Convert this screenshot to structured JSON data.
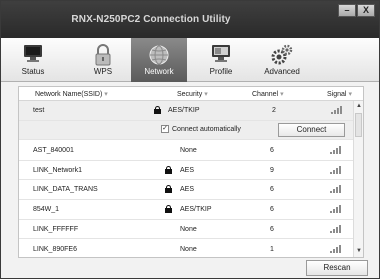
{
  "window": {
    "title": "RNX-N250PC2 Connection Utility",
    "minimize": "–",
    "close": "X"
  },
  "toolbar": {
    "tabs": [
      {
        "label": "Status",
        "icon": "monitor-icon"
      },
      {
        "label": "WPS",
        "icon": "lock-icon"
      },
      {
        "label": "Network",
        "icon": "globe-icon",
        "active": true
      },
      {
        "label": "Profile",
        "icon": "profile-monitor-icon"
      },
      {
        "label": "Advanced",
        "icon": "gears-icon"
      }
    ]
  },
  "table": {
    "headers": {
      "ssid": "Network Name(SSID)",
      "security": "Security",
      "channel": "Channel",
      "signal": "Signal"
    },
    "rows": [
      {
        "ssid": "test",
        "security": "AES/TKIP",
        "locked": true,
        "channel": "2",
        "signal": 4,
        "selected": true
      },
      {
        "ssid": "AST_840001",
        "security": "None",
        "locked": false,
        "channel": "6",
        "signal": 4
      },
      {
        "ssid": "LINK_Network1",
        "security": "AES",
        "locked": true,
        "channel": "9",
        "signal": 4
      },
      {
        "ssid": "LINK_DATA_TRANS",
        "security": "AES",
        "locked": true,
        "channel": "6",
        "signal": 4
      },
      {
        "ssid": "854W_1",
        "security": "AES/TKIP",
        "locked": true,
        "channel": "6",
        "signal": 4
      },
      {
        "ssid": "LINK_FFFFFF",
        "security": "None",
        "locked": false,
        "channel": "6",
        "signal": 4
      },
      {
        "ssid": "LINK_890FE6",
        "security": "None",
        "locked": false,
        "channel": "1",
        "signal": 4
      }
    ],
    "selected_actions": {
      "auto_connect_label": "Connect automatically",
      "auto_connect_checked": true,
      "connect_label": "Connect"
    }
  },
  "footer": {
    "rescan_label": "Rescan"
  },
  "colors": {
    "titlebar": "#2f2f2f",
    "active_tab": "#6e6e6e",
    "signal_bars": "#8c8c8c"
  }
}
